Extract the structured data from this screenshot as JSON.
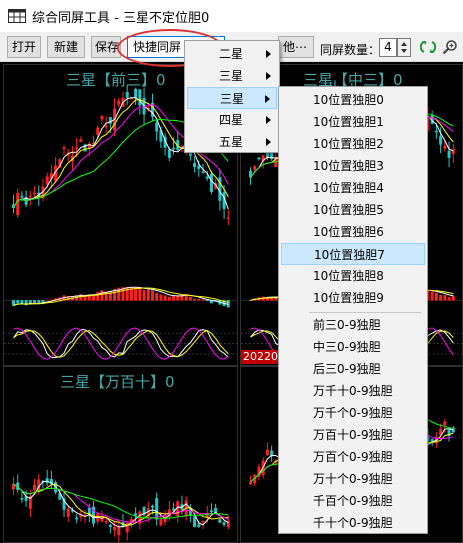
{
  "window": {
    "title": "综合同屏工具 - 三星不定位胆0"
  },
  "toolbar": {
    "open": "打开",
    "new": "新建",
    "save": "保存",
    "quick_combo": "快捷同屏",
    "more": "他⋯",
    "count_label": "同屏数量：",
    "count_value": "4"
  },
  "panels": [
    {
      "title": "三星【前三】0"
    },
    {
      "title": "三星【中三】0"
    },
    {
      "title": "三星【万百十】0"
    }
  ],
  "date_label": "20220",
  "menu1": {
    "items": [
      "二星",
      "三星",
      "三星",
      "四星",
      "五星"
    ],
    "highlighted": 2
  },
  "menu2": {
    "group1": [
      "10位置独胆0",
      "10位置独胆1",
      "10位置独胆2",
      "10位置独胆3",
      "10位置独胆4",
      "10位置独胆5",
      "10位置独胆6",
      "10位置独胆7",
      "10位置独胆8",
      "10位置独胆9"
    ],
    "group2": [
      "前三0-9独胆",
      "中三0-9独胆",
      "后三0-9独胆",
      "万千十0-9独胆",
      "万千个0-9独胆",
      "万百十0-9独胆",
      "万百个0-9独胆",
      "万十个0-9独胆",
      "千百个0-9独胆",
      "千十个0-9独胆"
    ],
    "highlighted": 7
  },
  "colors": {
    "up": "#ff2020",
    "down": "#20c8c8",
    "ma1": "#ffffff",
    "ma2": "#ffff00",
    "ma3": "#ff00ff",
    "ma4": "#00ff00",
    "highlight": "#e03030"
  }
}
